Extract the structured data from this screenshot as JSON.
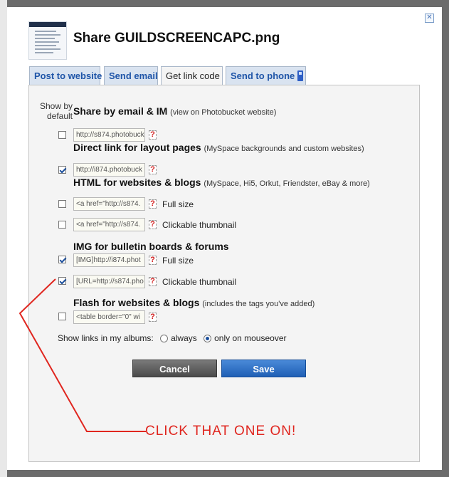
{
  "dialog": {
    "title": "Share GUILDSCREENCAPC.png",
    "close_symbol": "✕"
  },
  "tabs": [
    {
      "label": "Post to website",
      "active": false
    },
    {
      "label": "Send email",
      "active": false
    },
    {
      "label": "Get link code",
      "active": true
    },
    {
      "label": "Send to phone",
      "active": false,
      "icon": "phone-icon"
    }
  ],
  "show_by_default": "Show by default",
  "sections": [
    {
      "title": "Share by email & IM",
      "note": "(view on Photobucket website)"
    },
    {
      "title": "Direct link for layout pages",
      "note": "(MySpace backgrounds and custom websites)"
    },
    {
      "title": "HTML for websites & blogs",
      "note": "(MySpace, Hi5, Orkut, Friendster, eBay & more)"
    },
    {
      "title": "IMG for bulletin boards & forums",
      "note": ""
    },
    {
      "title": "Flash for websites & blogs",
      "note": "(includes the tags you've added)"
    }
  ],
  "rows": [
    {
      "value": "http://s874.photobuck",
      "label": "",
      "checked": false
    },
    {
      "value": "http://i874.photobuck",
      "label": "",
      "checked": true
    },
    {
      "value": "<a href=\"http://s874.",
      "label": "Full size",
      "checked": false
    },
    {
      "value": "<a href=\"http://s874.",
      "label": "Clickable thumbnail",
      "checked": false
    },
    {
      "value": "[IMG]http://i874.phot",
      "label": "Full size",
      "checked": true
    },
    {
      "value": "[URL=http://s874.pho",
      "label": "Clickable thumbnail",
      "checked": true
    },
    {
      "value": "<table border=\"0\" wi",
      "label": "",
      "checked": false
    }
  ],
  "help_symbol": "?",
  "links_option": {
    "label": "Show links in my albums:",
    "options": [
      "always",
      "only on mouseover"
    ],
    "selected": "only on mouseover"
  },
  "buttons": {
    "cancel": "Cancel",
    "save": "Save"
  },
  "annotation": "CLICK  THAT  ONE  ON!",
  "colors": {
    "annotation": "#e0261f",
    "save": "#1f5fb5",
    "tab_text": "#1f55a8"
  }
}
